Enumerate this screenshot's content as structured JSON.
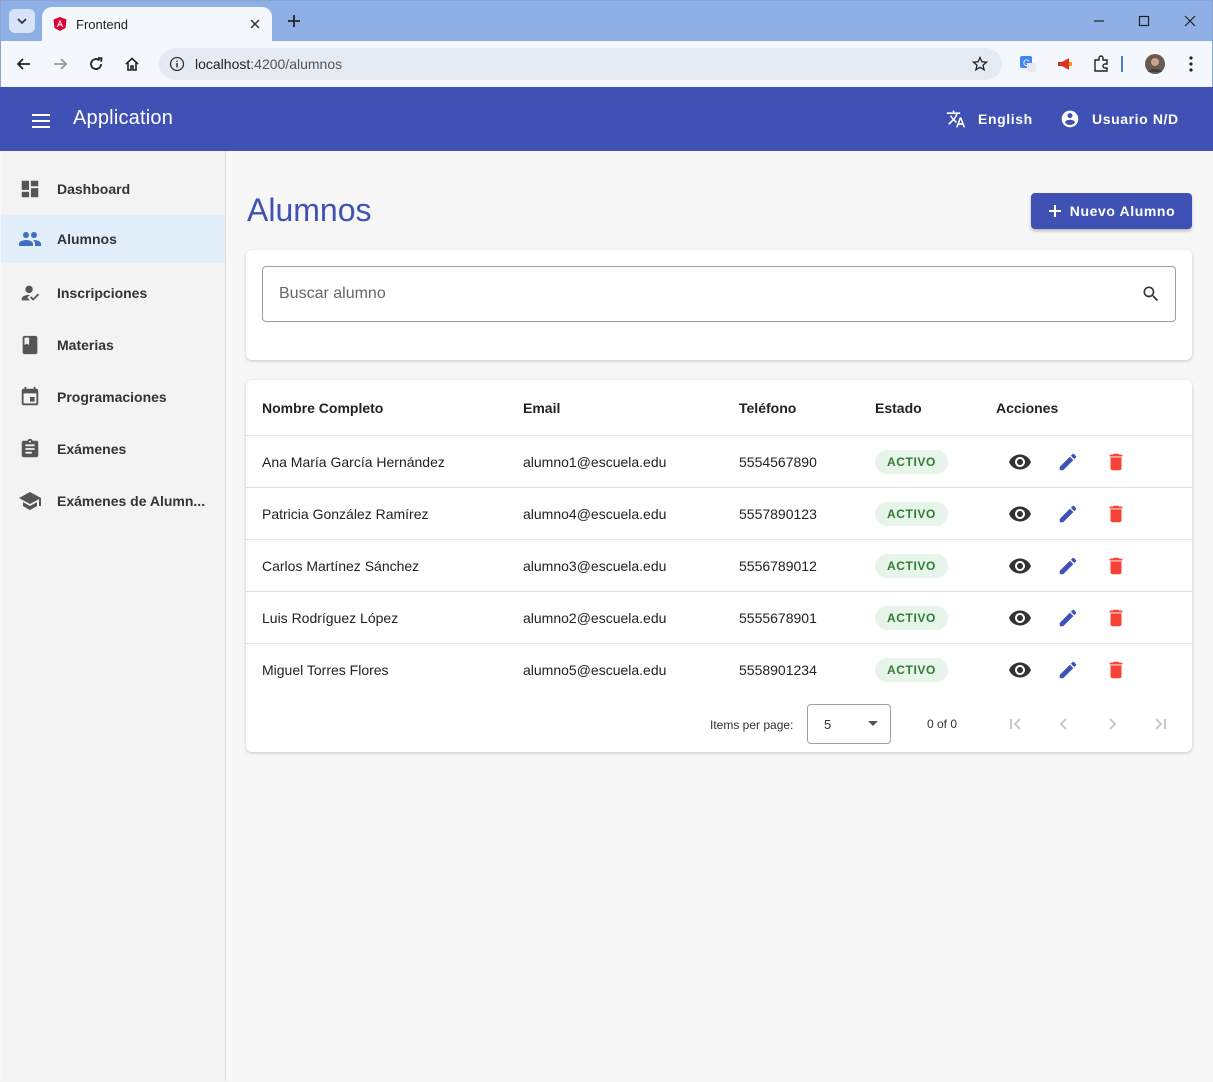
{
  "browser": {
    "tab_title": "Frontend",
    "url_host": "localhost",
    "url_path": ":4200/alumnos"
  },
  "app": {
    "title": "Application",
    "language_label": "English",
    "user_label": "Usuario N/D",
    "primary_color": "#3f51b5"
  },
  "sidebar": {
    "items": [
      {
        "label": "Dashboard",
        "icon": "dashboard-icon",
        "active": false
      },
      {
        "label": "Alumnos",
        "icon": "people-icon",
        "active": true
      },
      {
        "label": "Inscripciones",
        "icon": "how-to-reg-icon",
        "active": false
      },
      {
        "label": "Materias",
        "icon": "book-icon",
        "active": false
      },
      {
        "label": "Programaciones",
        "icon": "event-icon",
        "active": false
      },
      {
        "label": "Exámenes",
        "icon": "assignment-icon",
        "active": false
      },
      {
        "label": "Exámenes de Alumn...",
        "icon": "school-icon",
        "active": false
      }
    ]
  },
  "main": {
    "title": "Alumnos",
    "new_button_label": "Nuevo Alumno",
    "search_placeholder": "Buscar alumno",
    "table": {
      "headers": [
        "Nombre Completo",
        "Email",
        "Teléfono",
        "Estado",
        "Acciones"
      ],
      "rows": [
        {
          "name": "Ana María García Hernández",
          "email": "alumno1@escuela.edu",
          "phone": "5554567890",
          "status": "ACTIVO"
        },
        {
          "name": "Patricia González Ramírez",
          "email": "alumno4@escuela.edu",
          "phone": "5557890123",
          "status": "ACTIVO"
        },
        {
          "name": "Carlos Martínez Sánchez",
          "email": "alumno3@escuela.edu",
          "phone": "5556789012",
          "status": "ACTIVO"
        },
        {
          "name": "Luis Rodríguez López",
          "email": "alumno2@escuela.edu",
          "phone": "5555678901",
          "status": "ACTIVO"
        },
        {
          "name": "Miguel Torres Flores",
          "email": "alumno5@escuela.edu",
          "phone": "5558901234",
          "status": "ACTIVO"
        }
      ]
    },
    "paginator": {
      "items_per_page_label": "Items per page:",
      "page_size": "5",
      "range_label": "0 of 0"
    }
  }
}
